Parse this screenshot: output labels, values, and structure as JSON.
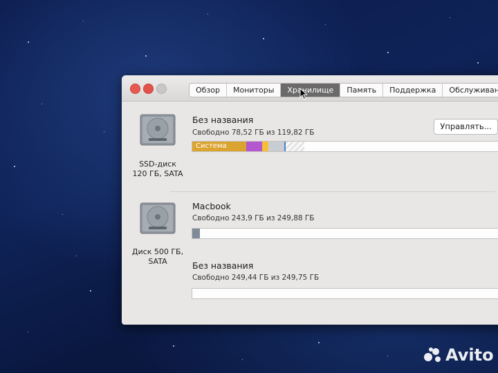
{
  "tabs": [
    "Обзор",
    "Мониторы",
    "Хранилище",
    "Память",
    "Поддержка",
    "Обслуживание"
  ],
  "active_tab": "Хранилище",
  "manage_button": "Управлять...",
  "disks": [
    {
      "icon": "hard-drive-icon",
      "label_line1": "SSD-диск",
      "label_line2": "120 ГБ, SATA",
      "volumes": [
        {
          "name": "Без названия",
          "free": "Свободно 78,52 ГБ из 119,82 ГБ",
          "segments": [
            {
              "label": "Система",
              "color": "#dba431",
              "fraction": 0.17
            },
            {
              "label": "",
              "color": "#b358cf",
              "fraction": 0.05
            },
            {
              "label": "",
              "color": "#f7bf34",
              "fraction": 0.02
            },
            {
              "label": "",
              "color": "#c7cdd3",
              "fraction": 0.05
            },
            {
              "label": "",
              "color": "#4a84c4",
              "fraction": 0.005
            },
            {
              "label": "",
              "color": "hatched",
              "fraction": 0.06
            }
          ]
        }
      ]
    },
    {
      "icon": "hard-drive-icon",
      "label_line1": "Диск 500 ГБ,",
      "label_line2": "SATA",
      "volumes": [
        {
          "name": "Macbook",
          "free": "Свободно 243,9 ГБ из 249,88 ГБ",
          "segments": [
            {
              "label": "",
              "color": "#7f8a99",
              "fraction": 0.024
            }
          ]
        },
        {
          "name": "Без названия",
          "free": "Свободно 249,44 ГБ из 249,75 ГБ",
          "segments": []
        }
      ]
    }
  ],
  "watermark": "Avito"
}
